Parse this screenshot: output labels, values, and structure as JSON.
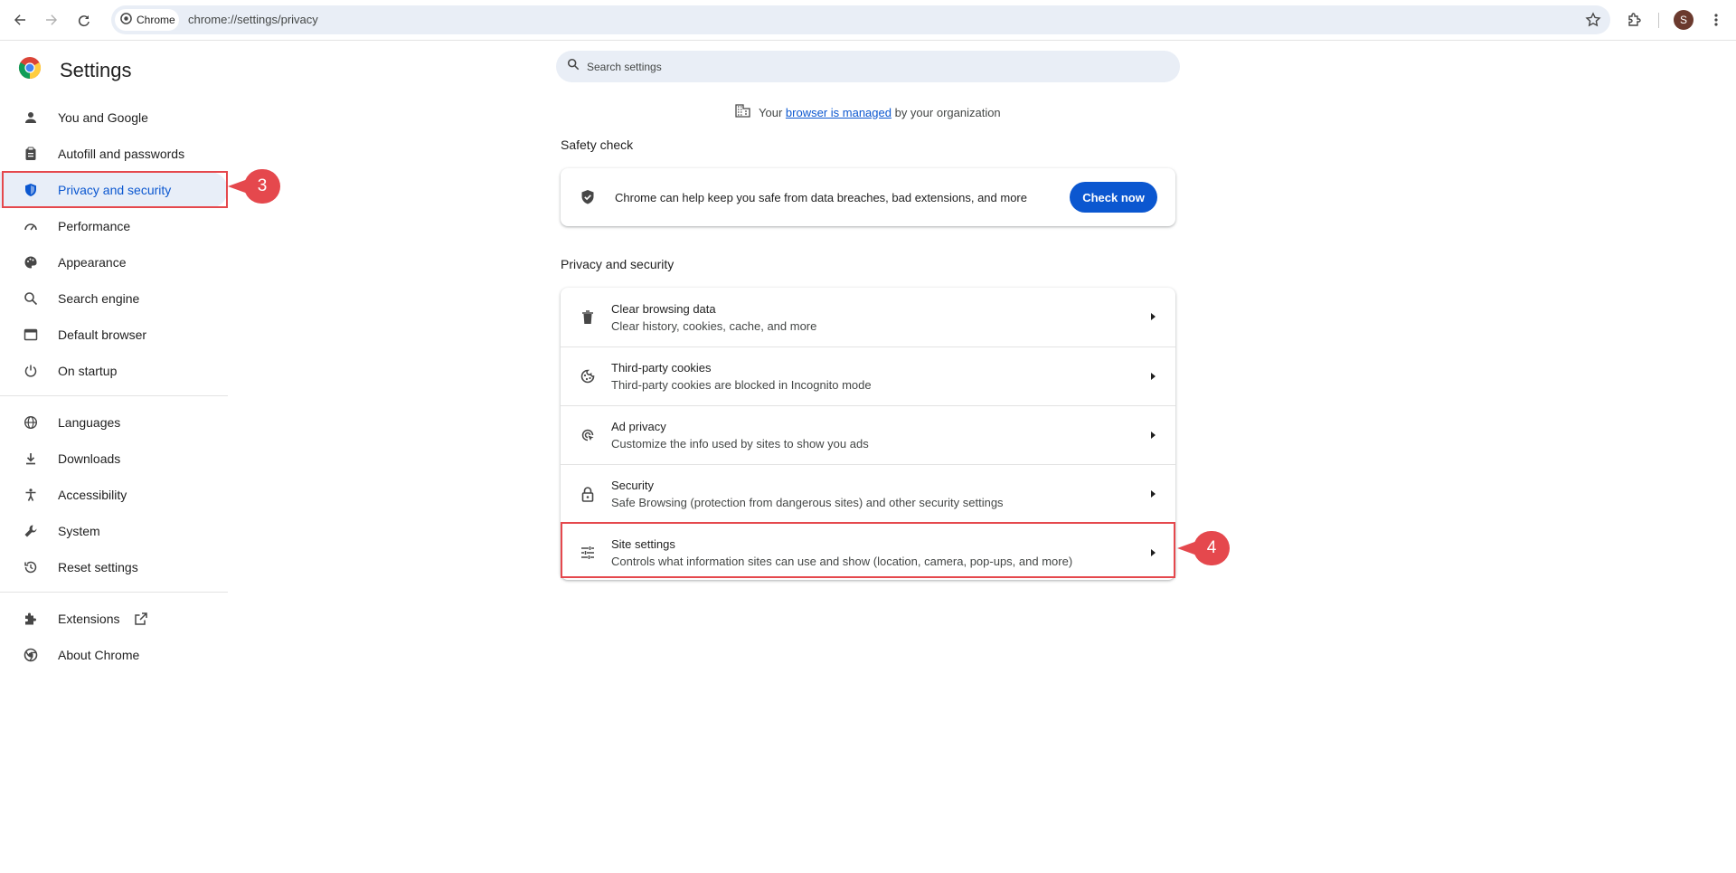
{
  "browser": {
    "chip_label": "Chrome",
    "url": "chrome://settings/privacy",
    "avatar_letter": "S"
  },
  "sidebar": {
    "title": "Settings",
    "items": [
      {
        "label": "You and Google",
        "icon": "person-icon"
      },
      {
        "label": "Autofill and passwords",
        "icon": "clipboard-icon"
      },
      {
        "label": "Privacy and security",
        "icon": "shield-icon",
        "active": true
      },
      {
        "label": "Performance",
        "icon": "speedometer-icon"
      },
      {
        "label": "Appearance",
        "icon": "palette-icon"
      },
      {
        "label": "Search engine",
        "icon": "search-icon"
      },
      {
        "label": "Default browser",
        "icon": "browser-window-icon"
      },
      {
        "label": "On startup",
        "icon": "power-icon"
      },
      {
        "label": "Languages",
        "icon": "globe-icon"
      },
      {
        "label": "Downloads",
        "icon": "download-icon"
      },
      {
        "label": "Accessibility",
        "icon": "accessibility-icon"
      },
      {
        "label": "System",
        "icon": "wrench-icon"
      },
      {
        "label": "Reset settings",
        "icon": "history-icon"
      },
      {
        "label": "Extensions",
        "icon": "puzzle-icon"
      },
      {
        "label": "About Chrome",
        "icon": "chrome-icon"
      }
    ]
  },
  "search": {
    "placeholder": "Search settings"
  },
  "managed": {
    "prefix": "Your",
    "link": "browser is managed",
    "suffix": "by your organization"
  },
  "safety_check": {
    "heading": "Safety check",
    "text": "Chrome can help keep you safe from data breaches, bad extensions, and more",
    "button": "Check now"
  },
  "privacy": {
    "heading": "Privacy and security",
    "rows": [
      {
        "title": "Clear browsing data",
        "sub": "Clear history, cookies, cache, and more",
        "icon": "trash-icon"
      },
      {
        "title": "Third-party cookies",
        "sub": "Third-party cookies are blocked in Incognito mode",
        "icon": "cookie-icon"
      },
      {
        "title": "Ad privacy",
        "sub": "Customize the info used by sites to show you ads",
        "icon": "ad-privacy-icon"
      },
      {
        "title": "Security",
        "sub": "Safe Browsing (protection from dangerous sites) and other security settings",
        "icon": "lock-icon"
      },
      {
        "title": "Site settings",
        "sub": "Controls what information sites can use and show (location, camera, pop-ups, and more)",
        "icon": "sliders-icon"
      }
    ]
  },
  "annotations": {
    "step_a": "3",
    "step_b": "4",
    "color": "#e5484d"
  },
  "colors": {
    "accent": "#0b57d0",
    "active_bg": "#e8eef8"
  }
}
